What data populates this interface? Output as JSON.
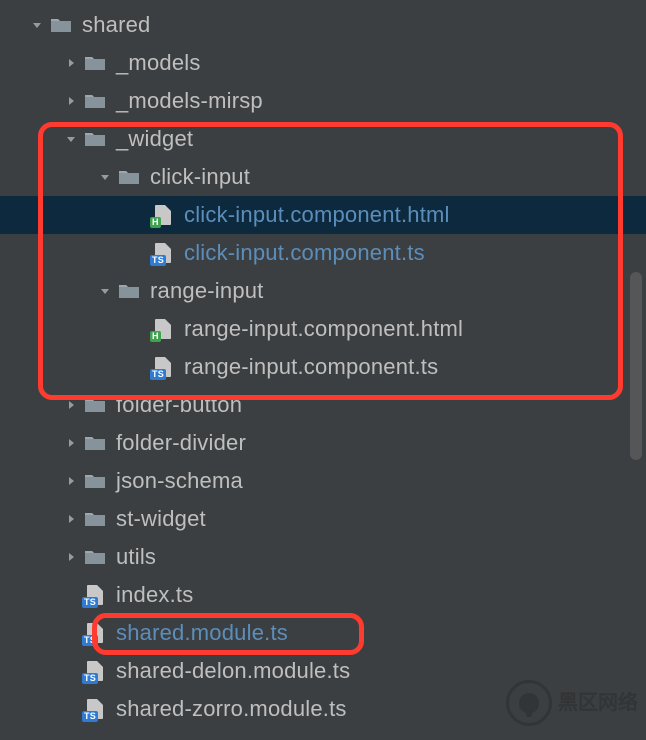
{
  "colors": {
    "accent": "#5b8eba",
    "selection": "#0d293e",
    "bg": "#3c3f41",
    "highlight_border": "#ff3b30"
  },
  "tree": [
    {
      "depth": 0,
      "expanded": true,
      "kind": "folder",
      "label": "shared"
    },
    {
      "depth": 1,
      "expanded": false,
      "kind": "folder",
      "label": "_models"
    },
    {
      "depth": 1,
      "expanded": false,
      "kind": "folder",
      "label": "_models-mirsp"
    },
    {
      "depth": 1,
      "expanded": true,
      "kind": "folder",
      "label": "_widget"
    },
    {
      "depth": 2,
      "expanded": true,
      "kind": "folder",
      "label": "click-input"
    },
    {
      "depth": 3,
      "kind": "file-html",
      "label": "click-input.component.html",
      "accent": true,
      "selected": true
    },
    {
      "depth": 3,
      "kind": "file-ts",
      "label": "click-input.component.ts",
      "accent": true
    },
    {
      "depth": 2,
      "expanded": true,
      "kind": "folder",
      "label": "range-input"
    },
    {
      "depth": 3,
      "kind": "file-html",
      "label": "range-input.component.html"
    },
    {
      "depth": 3,
      "kind": "file-ts",
      "label": "range-input.component.ts"
    },
    {
      "depth": 1,
      "expanded": false,
      "kind": "folder",
      "label": "folder-button"
    },
    {
      "depth": 1,
      "expanded": false,
      "kind": "folder",
      "label": "folder-divider"
    },
    {
      "depth": 1,
      "expanded": false,
      "kind": "folder",
      "label": "json-schema"
    },
    {
      "depth": 1,
      "expanded": false,
      "kind": "folder",
      "label": "st-widget"
    },
    {
      "depth": 1,
      "expanded": false,
      "kind": "folder",
      "label": "utils"
    },
    {
      "depth": 1,
      "kind": "file-ts",
      "label": "index.ts"
    },
    {
      "depth": 1,
      "kind": "file-ts",
      "label": "shared.module.ts",
      "accent": true
    },
    {
      "depth": 1,
      "kind": "file-ts",
      "label": "shared-delon.module.ts"
    },
    {
      "depth": 1,
      "kind": "file-ts",
      "label": "shared-zorro.module.ts"
    }
  ],
  "watermark_text": "黑区网络"
}
